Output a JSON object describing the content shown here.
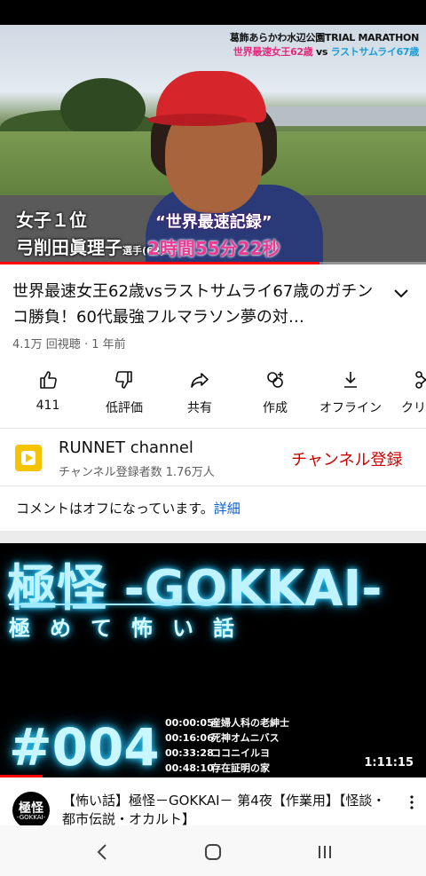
{
  "player": {
    "event_line1": "葛飾あらかわ水辺公園TRIAL MARATHON",
    "event_line2_a": "世界最速女王62歳",
    "event_line2_vs": " vs ",
    "event_line2_b": "ラストサムライ67歳",
    "caption_rank": "女子１位",
    "caption_name": "弓削田眞理子",
    "caption_name_suffix": "選手(62)",
    "caption_record": "“世界最速記録”",
    "caption_time": "2時間55分22秒",
    "progress": 0.75
  },
  "video": {
    "title": "世界最速女王62歳vsラストサムライ67歳のガチンコ勝負！60代最強フルマラソン夢の対…",
    "meta": "4.1万 回視聴 · 1 年前"
  },
  "actions": [
    {
      "icon": "like-icon",
      "label": "411"
    },
    {
      "icon": "dislike-icon",
      "label": "低評価"
    },
    {
      "icon": "share-icon",
      "label": "共有"
    },
    {
      "icon": "remix-icon",
      "label": "作成"
    },
    {
      "icon": "download-icon",
      "label": "オフライン"
    },
    {
      "icon": "clip-icon",
      "label": "クリ"
    }
  ],
  "channel": {
    "name": "RUNNET channel",
    "subscribers": "チャンネル登録者数 1.76万人",
    "subscribe_label": "チャンネル登録"
  },
  "comments": {
    "text": "コメントはオフになっています。",
    "link": "詳細"
  },
  "next_video": {
    "thumb_title": "極怪 -GOKKAI-",
    "thumb_subtitle": "極めて怖い話",
    "thumb_episode": "#004",
    "chapters": [
      {
        "time": "00:00:05",
        "title": "産婦人科の老紳士"
      },
      {
        "time": "00:16:06",
        "title": "死神オムニバス"
      },
      {
        "time": "00:33:28",
        "title": "ココニイルヨ"
      },
      {
        "time": "00:48:10",
        "title": "存在証明の家"
      }
    ],
    "duration": "1:11:15",
    "progress": 0.1,
    "avatar_main": "極怪",
    "avatar_sub": "-GOKKAI-",
    "title": "【怖い話】極怪－GOKKAI－ 第4夜【作業用】【怪談・都市伝説・オカルト】"
  },
  "colors": {
    "accent": "#ff0000",
    "subscribe": "#cc0000",
    "link": "#065fd4",
    "muted": "#606060"
  }
}
